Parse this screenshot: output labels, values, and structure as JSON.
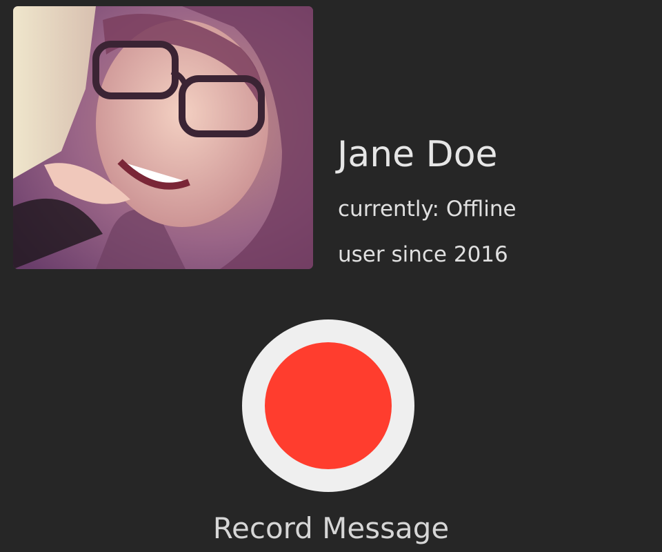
{
  "profile": {
    "photo_alt": "Profile photo",
    "name": "Jane Doe",
    "status": "currently: Offline",
    "member_since": "user since 2016"
  },
  "record": {
    "label": "Record Message",
    "icon": "record-icon",
    "accent_color": "#ff3d2e",
    "ring_color": "#efefef"
  },
  "theme": {
    "background": "#262626",
    "text": "#e6e6e6"
  }
}
